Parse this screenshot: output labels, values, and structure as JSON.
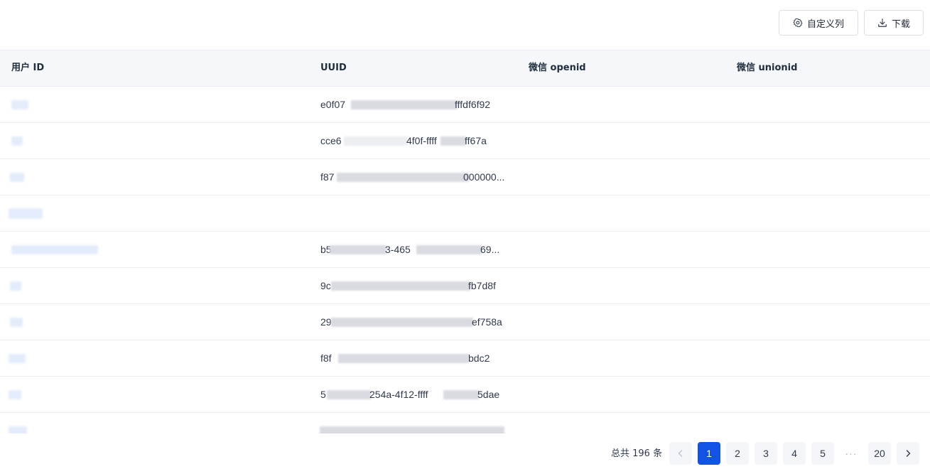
{
  "toolbar": {
    "customize_columns_label": "自定义列",
    "download_label": "下载"
  },
  "table": {
    "columns": [
      "用户 ID",
      "UUID",
      "微信 openid",
      "微信 unionid"
    ],
    "rows": [
      {
        "user_id": "",
        "uuid_left": "e0f07",
        "uuid_right": "fffdf6f92"
      },
      {
        "user_id": "",
        "uuid_left": "cce6",
        "uuid_mid": "4f0f-ffff",
        "uuid_right": "ff67a"
      },
      {
        "user_id": "",
        "uuid_left": "f87",
        "uuid_right": "000000..."
      },
      {
        "user_id": "",
        "uuid_left": ""
      },
      {
        "user_id": "",
        "uuid_left": "b5",
        "uuid_mid": "3-465",
        "uuid_right": "69..."
      },
      {
        "user_id": "",
        "uuid_left": "9c",
        "uuid_right": "fb7d8f"
      },
      {
        "user_id": "",
        "uuid_left": "29",
        "uuid_right": "ef758a"
      },
      {
        "user_id": "",
        "uuid_left": "f8f",
        "uuid_right": "bdc2"
      },
      {
        "user_id": "",
        "uuid_left": "5",
        "uuid_mid": "254a-4f12-ffff",
        "uuid_right": "5dae"
      },
      {
        "user_id": "",
        "uuid_left": ""
      }
    ]
  },
  "pagination": {
    "total_text": "总共 196 条",
    "pages": [
      "1",
      "2",
      "3",
      "4",
      "5"
    ],
    "ellipsis": "···",
    "last_page": "20",
    "current": "1"
  }
}
